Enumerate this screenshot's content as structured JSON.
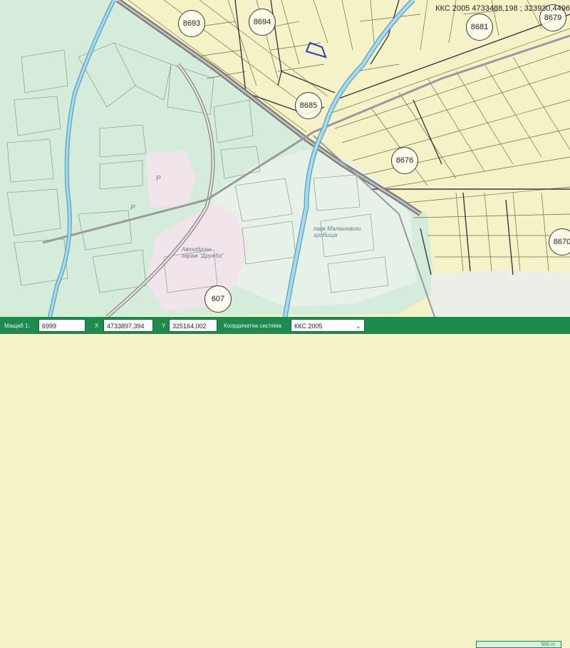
{
  "coordinate_readout": "ККС 2005 4733488,198 ; 323930,4496",
  "parcel_labels": [
    "8693",
    "8694",
    "8681",
    "8679",
    "8685",
    "8676",
    "8670",
    "607"
  ],
  "place_labels": {
    "bus_station": "Автобусен гараж \"Дружба\"",
    "park": "парк Малашевски гробища",
    "parking_symbol": "P",
    "bus_symbol": "P"
  },
  "toolbar": {
    "scale_label": "Мащаб 1:",
    "scale_value": "6999",
    "x_label": "X",
    "x_value": "4733897,394",
    "y_label": "Y",
    "y_value": "325164,002",
    "coord_system_label": "Координатна система",
    "coord_system_value": "ККС 2005",
    "chevron_icon": "chevron-down-icon"
  },
  "scale_bar": "500 m",
  "colors": {
    "cadastral_area": "#f6f2c8",
    "urban_green": "#d4ecd9",
    "park": "#e5f1e7",
    "river": "#8fd0e8",
    "toolbar": "#1e8a4e",
    "selected_parcel": "#2b3cc4"
  }
}
